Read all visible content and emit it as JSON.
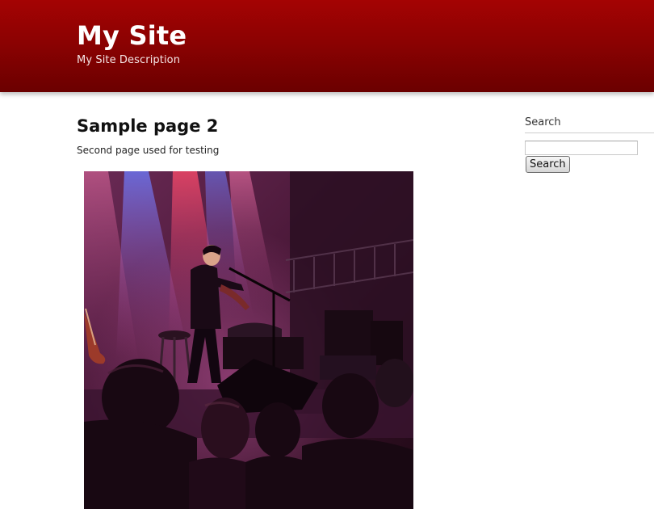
{
  "header": {
    "site_title": "My Site",
    "site_description": "My Site Description"
  },
  "main": {
    "page_title": "Sample page 2",
    "page_text": "Second page used for testing",
    "image": {
      "subject": "concert-photo-violinist-on-stage"
    }
  },
  "sidebar": {
    "search_title": "Search",
    "search_input_value": "",
    "search_button_label": "Search"
  },
  "colors": {
    "header_top": "#a40303",
    "header_bottom": "#6b0000",
    "background": "#ffffff"
  }
}
